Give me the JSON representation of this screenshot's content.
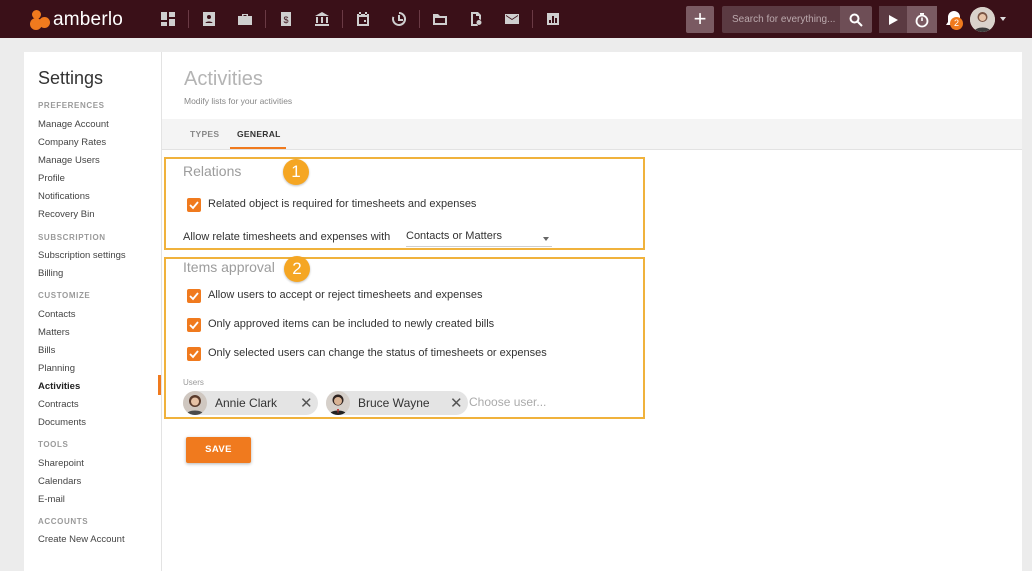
{
  "app": {
    "name": "amberlo"
  },
  "topbar": {
    "nav_icons": [
      "dashboard-icon",
      "contacts-icon",
      "briefcase-icon",
      "billing-icon",
      "bank-icon",
      "calendar-icon",
      "time-history-icon",
      "folder-icon",
      "document-search-icon",
      "mail-icon",
      "reports-icon"
    ],
    "add_label": "+",
    "search_placeholder": "Search for everything...",
    "notification_count": "2"
  },
  "sidebar": {
    "title": "Settings",
    "sections": [
      {
        "heading": "PREFERENCES",
        "items": [
          "Manage Account",
          "Company Rates",
          "Manage Users",
          "Profile",
          "Notifications",
          "Recovery Bin"
        ]
      },
      {
        "heading": "SUBSCRIPTION",
        "items": [
          "Subscription settings",
          "Billing"
        ]
      },
      {
        "heading": "CUSTOMIZE",
        "items": [
          "Contacts",
          "Matters",
          "Bills",
          "Planning",
          "Activities",
          "Contracts",
          "Documents"
        ]
      },
      {
        "heading": "TOOLS",
        "items": [
          "Sharepoint",
          "Calendars",
          "E-mail"
        ]
      },
      {
        "heading": "ACCOUNTS",
        "items": [
          "Create New Account"
        ]
      }
    ],
    "active_item": "Activities"
  },
  "main": {
    "title": "Activities",
    "subtitle": "Modify lists for your activities",
    "tabs": [
      {
        "label": "TYPES"
      },
      {
        "label": "GENERAL"
      }
    ],
    "active_tab": "GENERAL"
  },
  "relations": {
    "title": "Relations",
    "badge": "1",
    "checkbox_label": "Related object is required for timesheets and expenses",
    "checked": true,
    "relate_label": "Allow relate timesheets and expenses with",
    "relate_value": "Contacts or Matters"
  },
  "approval": {
    "title": "Items approval",
    "badge": "2",
    "options": [
      {
        "label": "Allow users to accept or reject timesheets and expenses",
        "checked": true
      },
      {
        "label": "Only approved items can be included to newly created bills",
        "checked": true
      },
      {
        "label": "Only selected users can change the status of timesheets or expenses",
        "checked": true
      }
    ],
    "users_label": "Users",
    "users": [
      {
        "name": "Annie Clark"
      },
      {
        "name": "Bruce Wayne"
      }
    ],
    "choose_placeholder": "Choose user..."
  },
  "save_label": "SAVE",
  "colors": {
    "accent": "#f07a1e",
    "topbar": "#3a1018",
    "highlight": "#f0b23c",
    "badge": "#f5a623"
  }
}
